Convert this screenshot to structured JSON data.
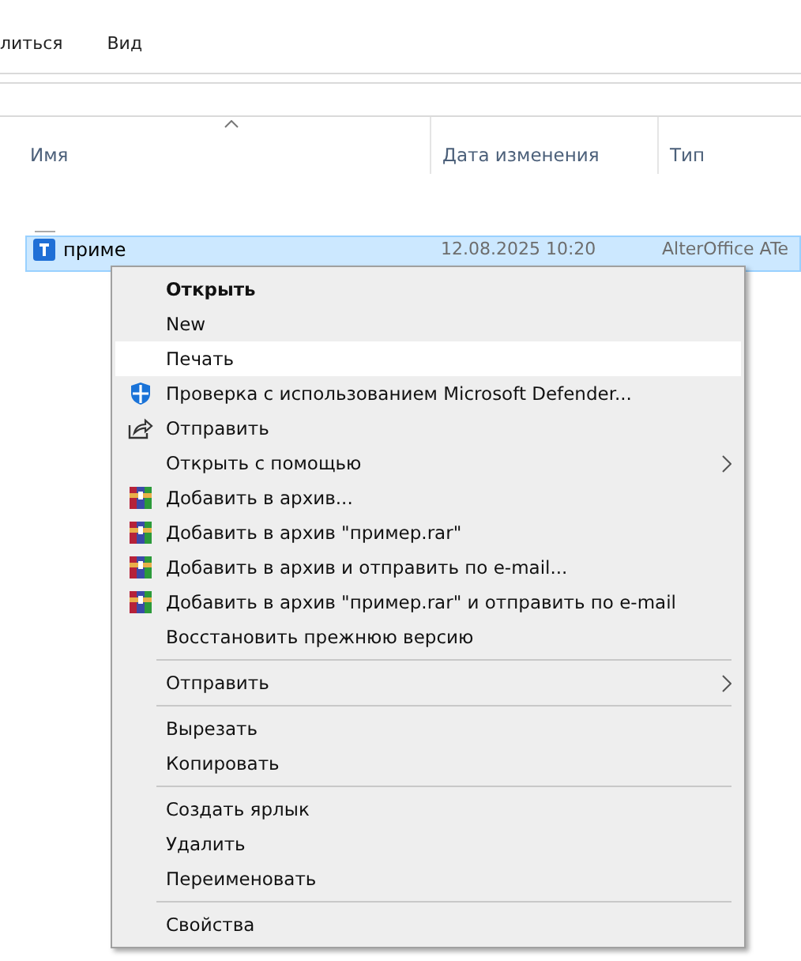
{
  "ribbon_tabs": [
    {
      "label": "литься"
    },
    {
      "label": "Вид"
    }
  ],
  "columns": [
    {
      "label": "Имя",
      "sorted": true
    },
    {
      "label": "Дата изменения",
      "sorted": false
    },
    {
      "label": "Тип",
      "sorted": false
    }
  ],
  "files": [
    {
      "name": "приме",
      "date": "12.08.2025 10:20",
      "type": "AlterOffice ATe",
      "selected": true
    }
  ],
  "context_menu": {
    "groups": [
      [
        {
          "label": "Открыть",
          "kind": "plain",
          "bold": true,
          "submenu": false,
          "selected": false
        },
        {
          "label": "New",
          "kind": "plain",
          "bold": false,
          "submenu": false,
          "selected": false
        },
        {
          "label": "Печать",
          "kind": "plain",
          "bold": false,
          "submenu": false,
          "selected": true
        },
        {
          "label": "Проверка с использованием Microsoft Defender...",
          "kind": "shield",
          "bold": false,
          "submenu": false,
          "selected": false
        },
        {
          "label": "Отправить",
          "kind": "share",
          "bold": false,
          "submenu": false,
          "selected": false
        },
        {
          "label": "Открыть с помощью",
          "kind": "plain",
          "bold": false,
          "submenu": true,
          "selected": false
        },
        {
          "label": "Добавить в архив...",
          "kind": "archive",
          "bold": false,
          "submenu": false,
          "selected": false
        },
        {
          "label": "Добавить в архив \"пример.rar\"",
          "kind": "archive",
          "bold": false,
          "submenu": false,
          "selected": false
        },
        {
          "label": "Добавить в архив и отправить по e-mail...",
          "kind": "archive",
          "bold": false,
          "submenu": false,
          "selected": false
        },
        {
          "label": "Добавить в архив \"пример.rar\" и отправить по e-mail",
          "kind": "archive",
          "bold": false,
          "submenu": false,
          "selected": false
        },
        {
          "label": "Восстановить прежнюю версию",
          "kind": "plain",
          "bold": false,
          "submenu": false,
          "selected": false
        }
      ],
      [
        {
          "label": "Отправить",
          "kind": "plain",
          "bold": false,
          "submenu": true,
          "selected": false
        }
      ],
      [
        {
          "label": "Вырезать",
          "kind": "plain",
          "bold": false,
          "submenu": false,
          "selected": false
        },
        {
          "label": "Копировать",
          "kind": "plain",
          "bold": false,
          "submenu": false,
          "selected": false
        }
      ],
      [
        {
          "label": "Создать ярлык",
          "kind": "plain",
          "bold": false,
          "submenu": false,
          "selected": false
        },
        {
          "label": "Удалить",
          "kind": "plain",
          "bold": false,
          "submenu": false,
          "selected": false
        },
        {
          "label": "Переименовать",
          "kind": "plain",
          "bold": false,
          "submenu": false,
          "selected": false
        }
      ],
      [
        {
          "label": "Свойства",
          "kind": "plain",
          "bold": false,
          "submenu": false,
          "selected": false
        }
      ]
    ]
  }
}
